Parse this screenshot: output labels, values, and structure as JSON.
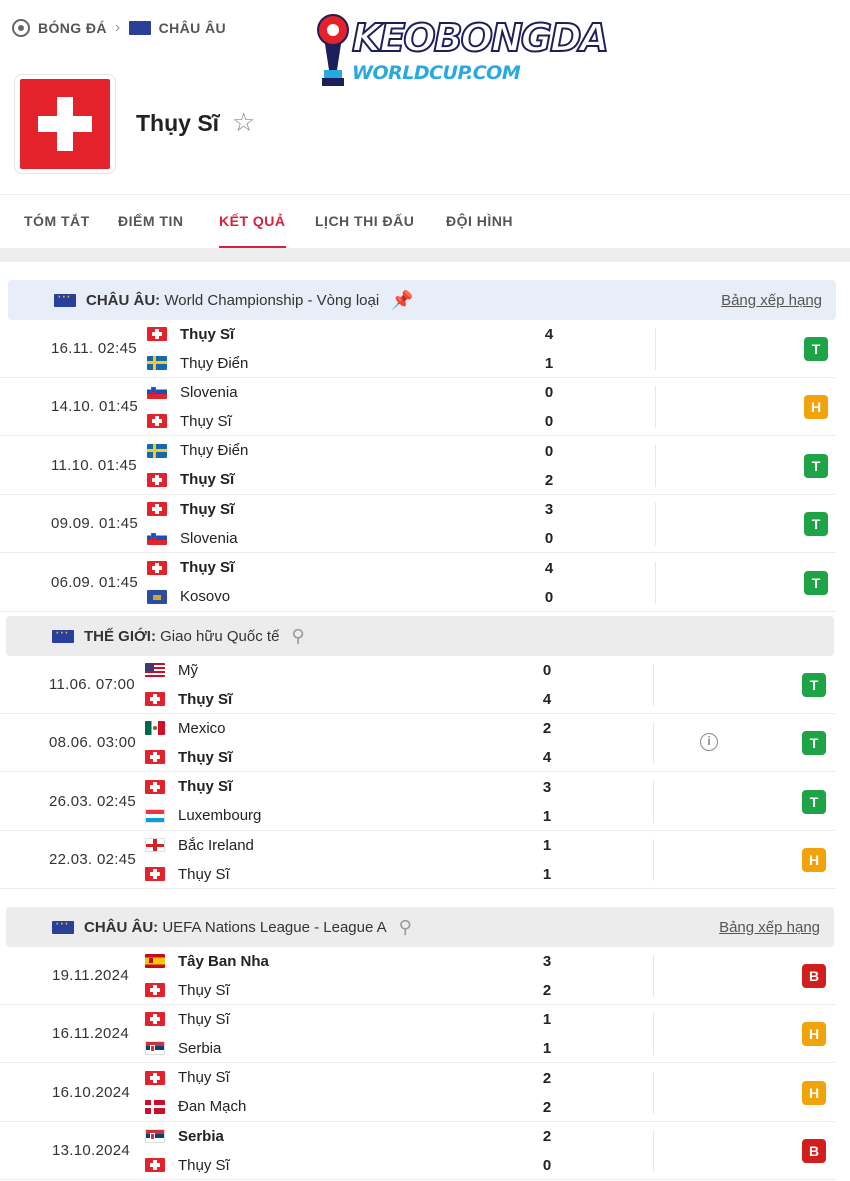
{
  "breadcrumb": {
    "items": [
      "BÓNG ĐÁ",
      "CHÂU ÂU"
    ]
  },
  "logo": {
    "line1": "KEOBONGDA",
    "line2": "WORLDCUP.COM"
  },
  "team": {
    "name": "Thụy Sĩ",
    "flag": "switzerland"
  },
  "tabs": [
    "TÓM TẮT",
    "ĐIỂM TIN",
    "KẾT QUẢ",
    "LỊCH THI ĐẤU",
    "ĐỘI HÌNH"
  ],
  "active_tab": "KẾT QUẢ",
  "colors": {
    "accent": "#d8203b",
    "win": "#1ea446",
    "draw": "#f0a30a",
    "loss": "#d11f1f"
  },
  "sections": [
    {
      "region": "CHÂU ÂU:",
      "competition": "World Championship - Vòng loại",
      "pin_icon": "pin-filled-icon",
      "standings_label": "Bảng xếp hạng",
      "matches": [
        {
          "time": "16.11. 02:45",
          "home": "Thụy Sĩ",
          "home_flag": "switzerland",
          "away": "Thụy Điển",
          "away_flag": "sweden",
          "home_score": "4",
          "away_score": "1",
          "winner": "home",
          "result": "T"
        },
        {
          "time": "14.10. 01:45",
          "home": "Slovenia",
          "home_flag": "slovenia",
          "away": "Thụy Sĩ",
          "away_flag": "switzerland",
          "home_score": "0",
          "away_score": "0",
          "winner": "",
          "result": "H"
        },
        {
          "time": "11.10. 01:45",
          "home": "Thụy Điển",
          "home_flag": "sweden",
          "away": "Thụy Sĩ",
          "away_flag": "switzerland",
          "home_score": "0",
          "away_score": "2",
          "winner": "away",
          "result": "T"
        },
        {
          "time": "09.09. 01:45",
          "home": "Thụy Sĩ",
          "home_flag": "switzerland",
          "away": "Slovenia",
          "away_flag": "slovenia",
          "home_score": "3",
          "away_score": "0",
          "winner": "home",
          "result": "T"
        },
        {
          "time": "06.09. 01:45",
          "home": "Thụy Sĩ",
          "home_flag": "switzerland",
          "away": "Kosovo",
          "away_flag": "kosovo",
          "home_score": "4",
          "away_score": "0",
          "winner": "home",
          "result": "T"
        }
      ]
    },
    {
      "region": "THẾ GIỚI:",
      "competition": "Giao hữu Quốc tế",
      "pin_icon": "pin-outline-icon",
      "standings_label": "",
      "matches": [
        {
          "time": "11.06. 07:00",
          "home": "Mỹ",
          "home_flag": "usa",
          "away": "Thụy Sĩ",
          "away_flag": "switzerland",
          "home_score": "0",
          "away_score": "4",
          "winner": "away",
          "result": "T"
        },
        {
          "time": "08.06. 03:00",
          "home": "Mexico",
          "home_flag": "mexico",
          "away": "Thụy Sĩ",
          "away_flag": "switzerland",
          "home_score": "2",
          "away_score": "4",
          "winner": "away",
          "result": "T",
          "info": "i"
        },
        {
          "time": "26.03. 02:45",
          "home": "Thụy Sĩ",
          "home_flag": "switzerland",
          "away": "Luxembourg",
          "away_flag": "luxembourg",
          "home_score": "3",
          "away_score": "1",
          "winner": "home",
          "result": "T"
        },
        {
          "time": "22.03. 02:45",
          "home": "Bắc Ireland",
          "home_flag": "northern-ireland",
          "away": "Thụy Sĩ",
          "away_flag": "switzerland",
          "home_score": "1",
          "away_score": "1",
          "winner": "",
          "result": "H"
        }
      ]
    },
    {
      "region": "CHÂU ÂU:",
      "competition": "UEFA Nations League - League A",
      "pin_icon": "pin-outline-icon",
      "standings_label": "Bảng xếp hạng",
      "matches": [
        {
          "time": "19.11.2024",
          "home": "Tây Ban Nha",
          "home_flag": "spain",
          "away": "Thụy Sĩ",
          "away_flag": "switzerland",
          "home_score": "3",
          "away_score": "2",
          "winner": "home",
          "result": "B"
        },
        {
          "time": "16.11.2024",
          "home": "Thụy Sĩ",
          "home_flag": "switzerland",
          "away": "Serbia",
          "away_flag": "serbia",
          "home_score": "1",
          "away_score": "1",
          "winner": "",
          "result": "H"
        },
        {
          "time": "16.10.2024",
          "home": "Thụy Sĩ",
          "home_flag": "switzerland",
          "away": "Đan Mạch",
          "away_flag": "denmark",
          "home_score": "2",
          "away_score": "2",
          "winner": "",
          "result": "H"
        },
        {
          "time": "13.10.2024",
          "home": "Serbia",
          "home_flag": "serbia",
          "away": "Thụy Sĩ",
          "away_flag": "switzerland",
          "home_score": "2",
          "away_score": "0",
          "winner": "home",
          "result": "B"
        }
      ]
    }
  ]
}
